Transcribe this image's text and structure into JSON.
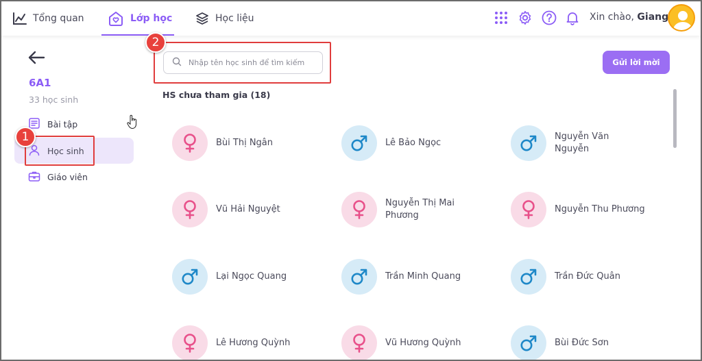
{
  "topbar": {
    "nav": [
      {
        "label": "Tổng quan",
        "icon": "chart-icon"
      },
      {
        "label": "Lớp học",
        "icon": "house-heart-icon",
        "active": true
      },
      {
        "label": "Học liệu",
        "icon": "layers-icon"
      }
    ],
    "greeting_prefix": "Xin chào, ",
    "user_name": "Giang"
  },
  "sidebar": {
    "class_name": "6A1",
    "student_count": "33 học sinh",
    "items": [
      {
        "label": "Bài tập",
        "icon": "assignment-icon"
      },
      {
        "label": "Học sinh",
        "icon": "person-icon",
        "active": true
      },
      {
        "label": "Giáo viên",
        "icon": "briefcase-icon"
      }
    ]
  },
  "search": {
    "placeholder": "Nhập tên học sinh để tìm kiếm",
    "value": ""
  },
  "invite_button": "Gửi lời mời",
  "section_title": "HS chưa tham gia (18)",
  "students": [
    {
      "name": "Bùi Thị Ngân",
      "gender": "female"
    },
    {
      "name": "Lê Bảo Ngọc",
      "gender": "male"
    },
    {
      "name": "Nguyễn Văn Nguyễn",
      "gender": "male"
    },
    {
      "name": "Vũ Hải Nguyệt",
      "gender": "female"
    },
    {
      "name": "Nguyễn Thị Mai Phương",
      "gender": "female"
    },
    {
      "name": "Nguyễn Thu Phương",
      "gender": "female"
    },
    {
      "name": "Lại Ngọc Quang",
      "gender": "male"
    },
    {
      "name": "Trần Minh Quang",
      "gender": "male"
    },
    {
      "name": "Trần Đức Quân",
      "gender": "male"
    },
    {
      "name": "Lê Hương Quỳnh",
      "gender": "female"
    },
    {
      "name": "Vũ Hương Quỳnh",
      "gender": "female"
    },
    {
      "name": "Bùi Đức Sơn",
      "gender": "male"
    }
  ],
  "annotations": {
    "badge_1": "1",
    "badge_2": "2"
  },
  "colors": {
    "accent": "#8b5cf6",
    "button": "#9b6ef3",
    "female_bg": "#f9dbe7",
    "male_bg": "#d6ebf7",
    "female_icon": "#e8508a",
    "male_icon": "#1e88c8",
    "annotation_red": "#e03c3c"
  }
}
